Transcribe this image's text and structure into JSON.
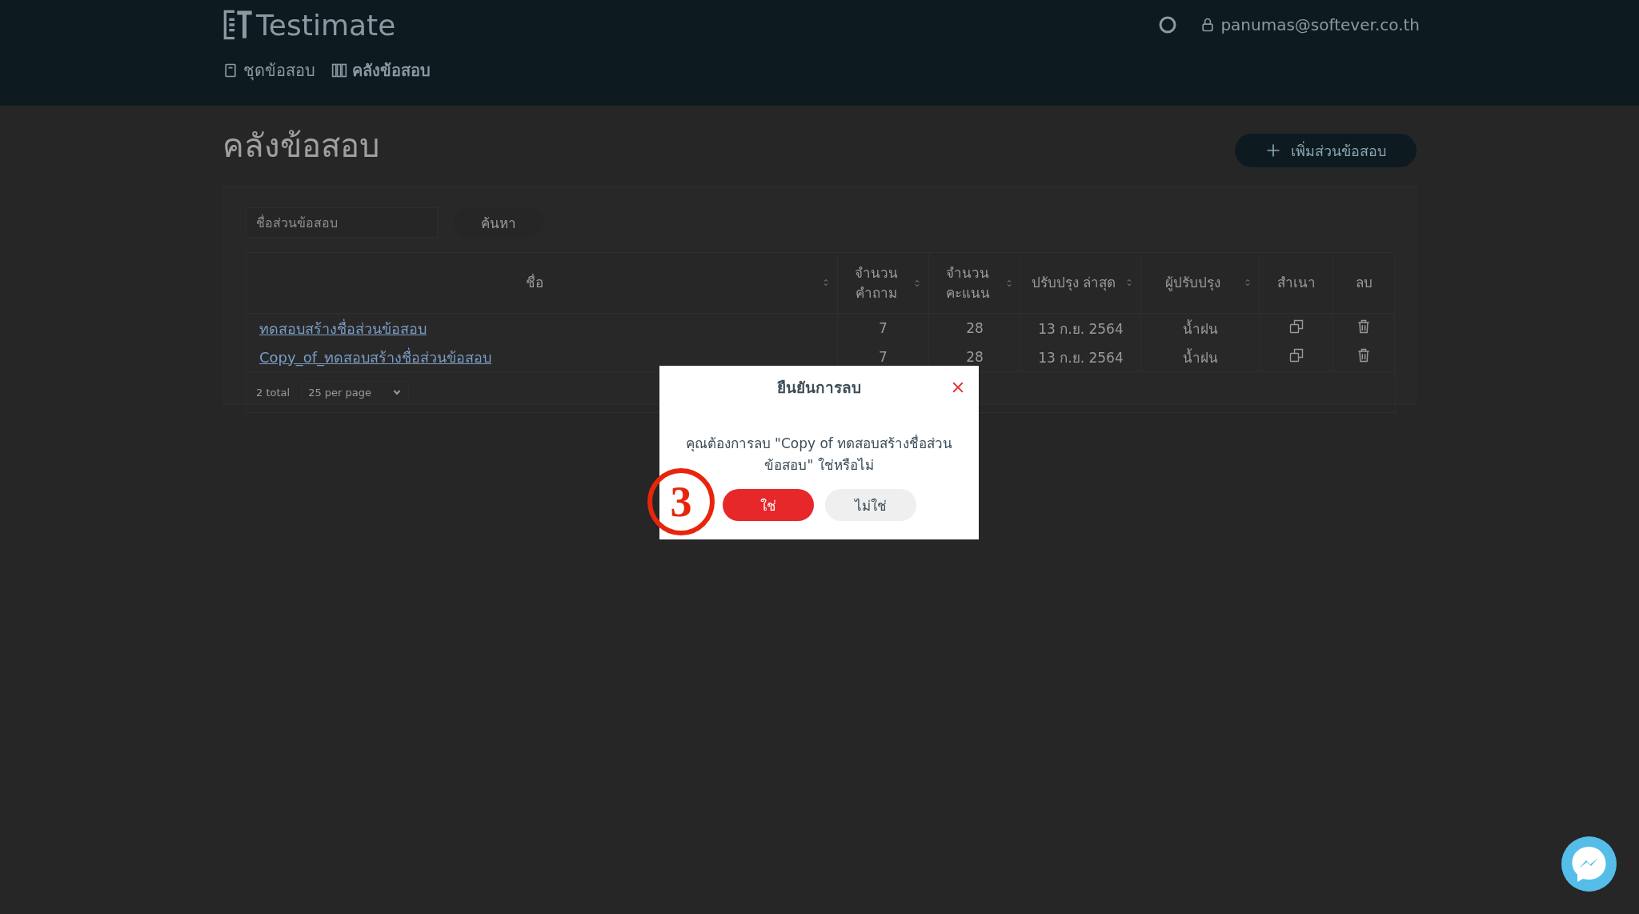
{
  "header": {
    "logo": "Testimate",
    "user": "panumas@softever.co.th",
    "nav": [
      {
        "label": "ชุดข้อสอบ",
        "kind": "book",
        "selected": false
      },
      {
        "label": "คลังข้อสอบ",
        "kind": "library",
        "selected": true
      }
    ]
  },
  "page_title": "คลังข้อสอบ",
  "add_button": "เพิ่มส่วนข้อสอบ",
  "search": {
    "placeholder": "ชื่อส่วนข้อสอบ",
    "button": "ค้นหา"
  },
  "table": {
    "columns": [
      {
        "label": "ชื่อ",
        "sortable": true
      },
      {
        "label": "จำนวน คำถาม",
        "sortable": true
      },
      {
        "label": "จำนวน คะแนน",
        "sortable": true
      },
      {
        "label": "ปรับปรุง ล่าสุด",
        "sortable": true
      },
      {
        "label": "ผู้ปรับปรุง",
        "sortable": true
      },
      {
        "label": "สำเนา",
        "sortable": false
      },
      {
        "label": "ลบ",
        "sortable": false
      }
    ],
    "rows": [
      {
        "name": "ทดสอบสร้างชื่อส่วนข้อสอบ",
        "questions": "7",
        "score": "28",
        "updated": "13 ก.ย. 2564",
        "updater": "น้ำฝน"
      },
      {
        "name": "Copy_of_ทดสอบสร้างชื่อส่วนข้อสอบ",
        "questions": "7",
        "score": "28",
        "updated": "13 ก.ย. 2564",
        "updater": "น้ำฝน"
      }
    ]
  },
  "pagination": {
    "total": "2 total",
    "per_page": "25 per page"
  },
  "dialog": {
    "title": "ยืนยันการลบ",
    "message": "คุณต้องการลบ \"Copy of  ทดสอบสร้างชื่อส่วนข้อสอบ\" ใช่หรือไม่",
    "confirm": "ใช่",
    "cancel": "ไม่ใช่"
  },
  "annotation": {
    "label": "3"
  }
}
